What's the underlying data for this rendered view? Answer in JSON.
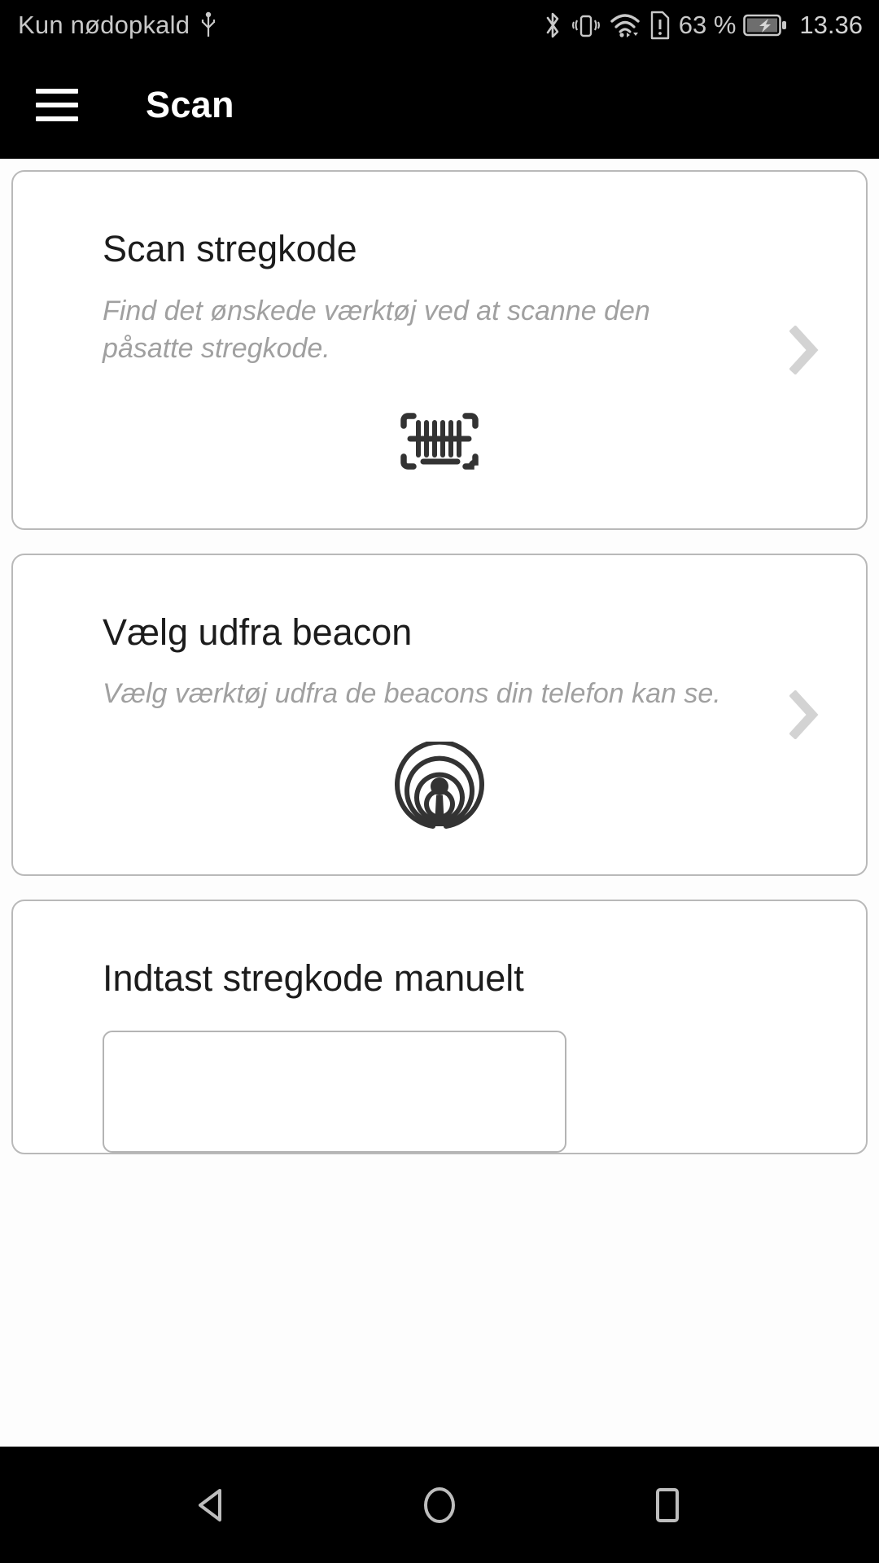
{
  "status_bar": {
    "carrier": "Kun nødopkald",
    "usb_icon": "usb-icon",
    "bluetooth_icon": "bluetooth-icon",
    "vibrate_icon": "vibrate-icon",
    "wifi_icon": "wifi-icon",
    "sim_alert_icon": "sim-alert-icon",
    "battery_percent": "63 %",
    "battery_icon": "battery-charging-icon",
    "clock": "13.36"
  },
  "app_bar": {
    "menu_icon": "hamburger-menu-icon",
    "title": "Scan"
  },
  "cards": [
    {
      "title": "Scan stregkode",
      "description": "Find det ønskede værktøj ved at scanne den påsatte stregkode.",
      "icon": "barcode-scan-icon",
      "chevron": "chevron-right-icon"
    },
    {
      "title": "Vælg udfra beacon",
      "description": "Vælg værktøj udfra de beacons din telefon kan se.",
      "icon": "beacon-broadcast-icon",
      "chevron": "chevron-right-icon"
    },
    {
      "title": "Indtast stregkode manuelt",
      "input_value": "",
      "input_placeholder": ""
    }
  ],
  "nav_bar": {
    "back": "back-icon",
    "home": "home-icon",
    "recents": "recents-icon"
  },
  "colors": {
    "bar_background": "#000000",
    "page_background": "#fdfdfd",
    "card_border": "#b9b9b9",
    "title_text": "#1c1c1c",
    "muted_text": "#a0a0a0",
    "status_text": "#c9c9c9",
    "icon_dark": "#333333",
    "chevron": "#cfcfcf"
  }
}
